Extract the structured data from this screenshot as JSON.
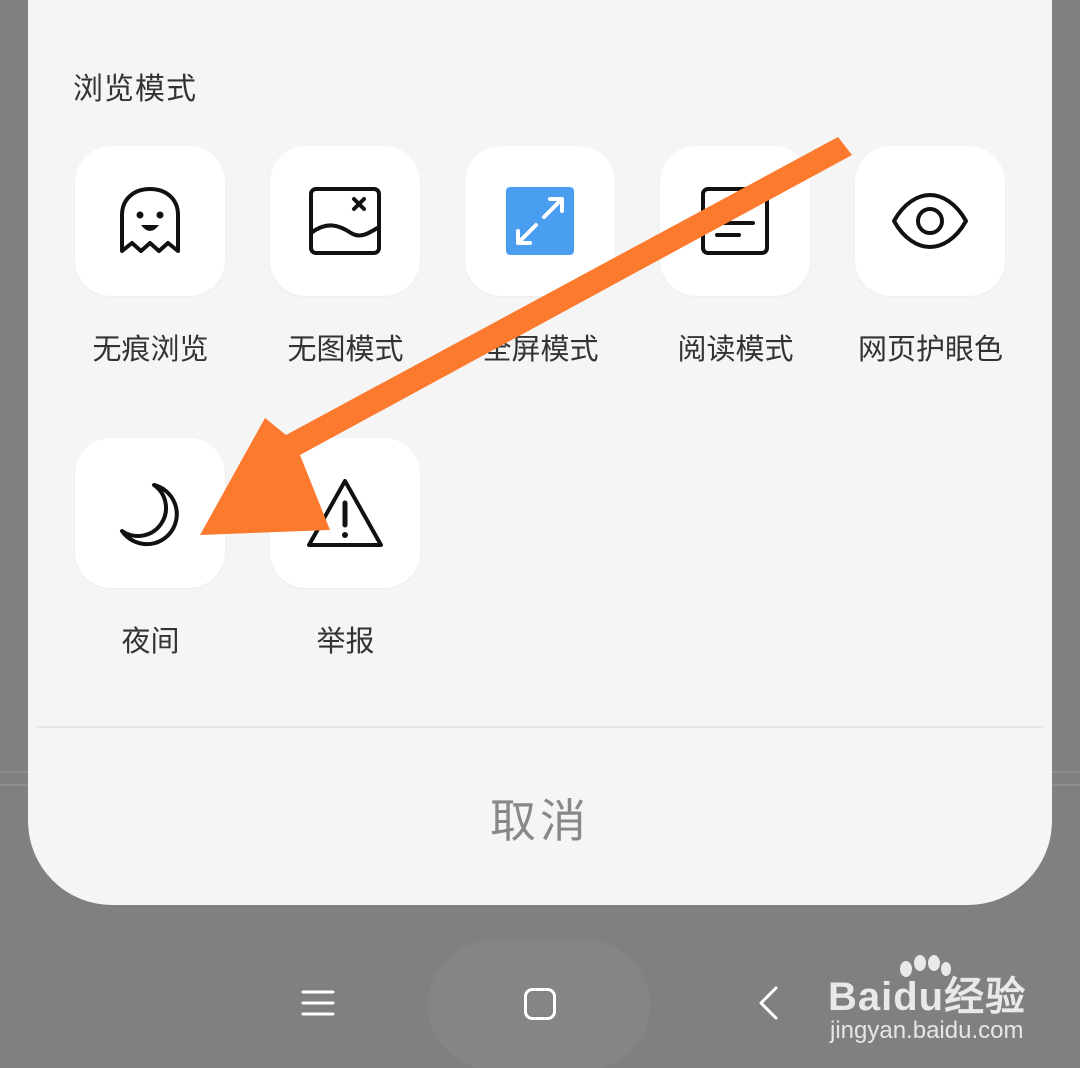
{
  "sheet": {
    "section_title": "浏览模式",
    "tiles": [
      {
        "label": "无痕浏览",
        "icon": "ghost-icon"
      },
      {
        "label": "无图模式",
        "icon": "no-image-icon"
      },
      {
        "label": "全屏模式",
        "icon": "fullscreen-icon"
      },
      {
        "label": "阅读模式",
        "icon": "reading-icon"
      },
      {
        "label": "网页护眼色",
        "icon": "eye-icon"
      },
      {
        "label": "夜间",
        "icon": "moon-icon"
      },
      {
        "label": "举报",
        "icon": "warning-icon"
      }
    ],
    "cancel_label": "取消"
  },
  "navbar": {
    "icons": [
      "menu-icon",
      "home-icon",
      "back-icon"
    ]
  },
  "watermark": {
    "logo": "Baidu经验",
    "url": "jingyan.baidu.com"
  },
  "colors": {
    "accent_blue": "#4a9ef0",
    "annotation_arrow": "#fb7a2e",
    "sheet_bg": "#f5f5f5",
    "backdrop": "#808080"
  }
}
